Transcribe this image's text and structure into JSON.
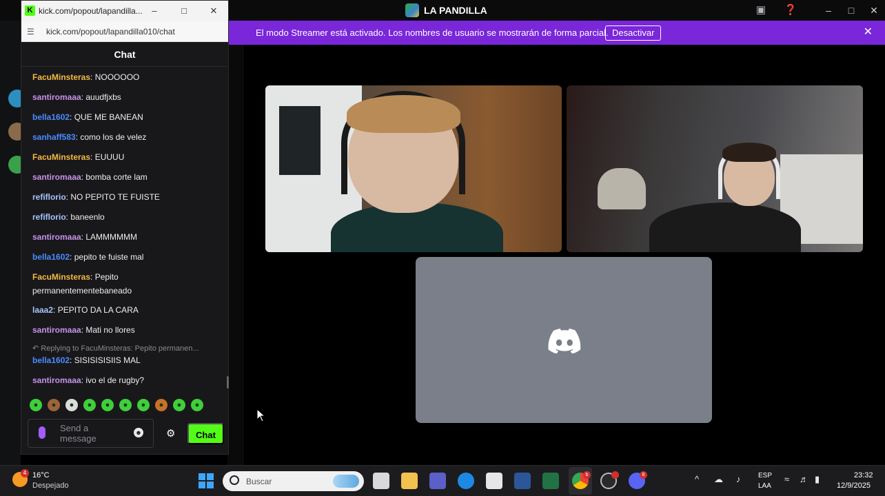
{
  "discord": {
    "server_name": "LA PANDILLA",
    "banner_text": "El modo Streamer está activado. Los nombres de usuario se mostrarán de forma parcial.",
    "banner_button": "Desactivar",
    "accent": "#7a26d9"
  },
  "popup": {
    "tab_title": "kick.com/popout/lapandilla...",
    "url": "kick.com/popout/lapandilla010/chat",
    "chat_header": "Chat",
    "messages": [
      {
        "user": "FacuMinsteras",
        "color": "#f5b942",
        "text": ": NOOOOOO"
      },
      {
        "user": "santiromaaa",
        "color": "#c792ea",
        "text": ": auudfjxbs"
      },
      {
        "user": "bella1602",
        "color": "#4a8cff",
        "text": ": QUE ME BANEAN"
      },
      {
        "user": "sanhaff583",
        "color": "#4a8cff",
        "text": ": como los de velez"
      },
      {
        "user": "FacuMinsteras",
        "color": "#f5b942",
        "text": ": EUUUU"
      },
      {
        "user": "santiromaaa",
        "color": "#c792ea",
        "text": ": bomba corte lam"
      },
      {
        "user": "refiflorio",
        "color": "#a7c4ff",
        "text": ": NO PEPITO TE FUISTE"
      },
      {
        "user": "refiflorio",
        "color": "#a7c4ff",
        "text": ": baneenlo"
      },
      {
        "user": "santiromaaa",
        "color": "#c792ea",
        "text": ": LAMMMMMM"
      },
      {
        "user": "bella1602",
        "color": "#4a8cff",
        "text": ": pepito te fuiste mal"
      },
      {
        "user": "FacuMinsteras",
        "color": "#f5b942",
        "text": ": Pepito permanentementebaneado"
      },
      {
        "user": "laaa2",
        "color": "#a7c4ff",
        "text": ": PEPITO DA LA CARA"
      },
      {
        "user": "santiromaaa",
        "color": "#c792ea",
        "text": ": Mati no llores"
      },
      {
        "user": "bella1602",
        "color": "#4a8cff",
        "text": ": SISISISISIIS MAL"
      },
      {
        "user": "santiromaaa",
        "color": "#c792ea",
        "text": ": ivo el de rugby?"
      }
    ],
    "reply_text": "Replying to FacuMinsteras: Pepito permanen...",
    "input_placeholder": "Send a message",
    "send_label": "Chat",
    "accent": "#53fc18"
  },
  "taskbar": {
    "weather_temp": "16°C",
    "weather_cond": "Despejado",
    "weather_badge": "4",
    "search_placeholder": "Buscar",
    "chrome_badge": "b",
    "discord_badge": "8",
    "lang_top": "ESP",
    "lang_bottom": "LAA",
    "time": "23:32",
    "date": "12/9/2025"
  }
}
